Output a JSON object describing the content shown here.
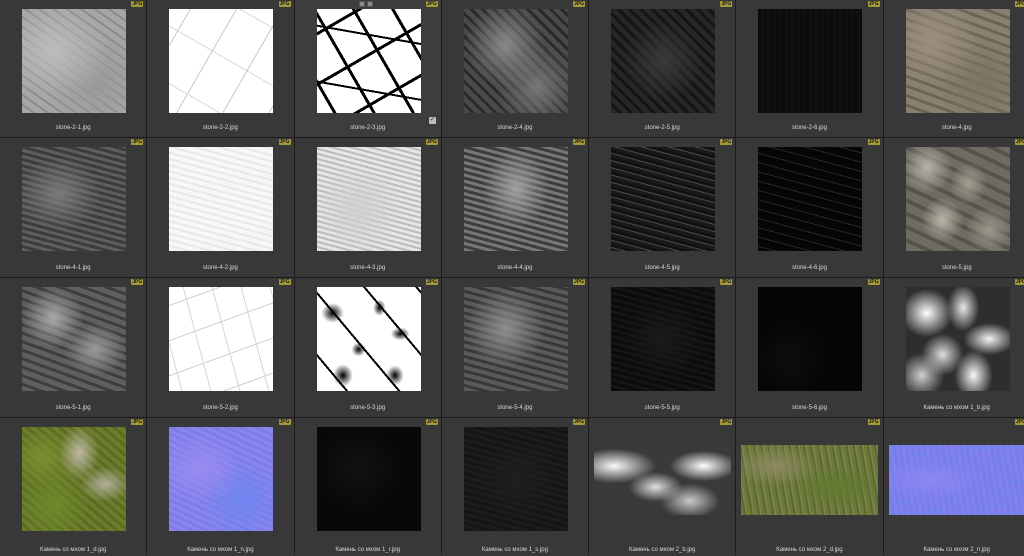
{
  "badge_label": "JPG",
  "items": [
    {
      "caption": "stone-2-1.jpg",
      "texture": "gray-crack"
    },
    {
      "caption": "stone-2-2.jpg",
      "texture": "white-lines"
    },
    {
      "caption": "stone-2-3.jpg",
      "texture": "bw-crack"
    },
    {
      "caption": "stone-2-4.jpg",
      "texture": "dark-rock"
    },
    {
      "caption": "stone-2-5.jpg",
      "texture": "darker-rock"
    },
    {
      "caption": "stone-2-6.jpg",
      "texture": "black"
    },
    {
      "caption": "stone-4.jpg",
      "texture": "tan-rock"
    },
    {
      "caption": "stone-4-1.jpg",
      "texture": "gray-rough"
    },
    {
      "caption": "stone-4-2.jpg",
      "texture": "white-rough"
    },
    {
      "caption": "stone-4-3.jpg",
      "texture": "light-rough"
    },
    {
      "caption": "stone-4-4.jpg",
      "texture": "midgray-rough"
    },
    {
      "caption": "stone-4-5.jpg",
      "texture": "dark-speck"
    },
    {
      "caption": "stone-4-6.jpg",
      "texture": "dark-speck2"
    },
    {
      "caption": "stone-5.jpg",
      "texture": "stones"
    },
    {
      "caption": "stone-5-1.jpg",
      "texture": "gray-chunky"
    },
    {
      "caption": "stone-5-2.jpg",
      "texture": "white-spots"
    },
    {
      "caption": "stone-5-3.jpg",
      "texture": "bw-blobs"
    },
    {
      "caption": "stone-5-4.jpg",
      "texture": "gray-mid"
    },
    {
      "caption": "stone-5-5.jpg",
      "texture": "very-dark"
    },
    {
      "caption": "stone-5-6.jpg",
      "texture": "black2"
    },
    {
      "caption": "Камень со мхом 1_b.jpg",
      "texture": "clouds"
    },
    {
      "caption": "Камень со мхом 1_d.jpg",
      "texture": "moss"
    },
    {
      "caption": "Камень со мхом 1_n.jpg",
      "texture": "normal"
    },
    {
      "caption": "Камень со мхом 1_r.jpg",
      "texture": "black3"
    },
    {
      "caption": "Камень со мхом 1_s.jpg",
      "texture": "dark-gray"
    },
    {
      "caption": "Камень со мхом 2_b.jpg",
      "texture": "clouds-wide",
      "wide": true
    },
    {
      "caption": "Камень со мхом 2_d.jpg",
      "texture": "grass",
      "wide": true
    },
    {
      "caption": "Камень со мхом 2_n.jpg",
      "texture": "normal-wide",
      "wide": true
    }
  ],
  "selected_index": 2
}
